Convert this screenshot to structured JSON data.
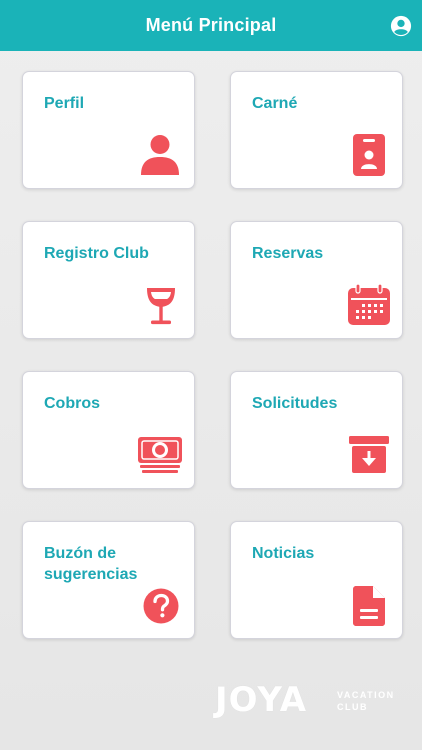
{
  "header": {
    "title": "Menú Principal",
    "profile_icon": "account-circle-icon"
  },
  "colors": {
    "header_bg": "#1ab3b8",
    "label_text": "#1ea8b4",
    "icon_accent": "#f0525a",
    "card_bg": "#ffffff"
  },
  "menu": {
    "items": [
      {
        "label": "Perfil",
        "icon": "person-icon"
      },
      {
        "label": "Carné",
        "icon": "id-badge-icon"
      },
      {
        "label": "Registro Club",
        "icon": "wine-glass-icon"
      },
      {
        "label": "Reservas",
        "icon": "calendar-icon"
      },
      {
        "label": "Cobros",
        "icon": "cash-icon"
      },
      {
        "label": "Solicitudes",
        "icon": "archive-download-icon"
      },
      {
        "label": "Buzón de sugerencias",
        "icon": "help-circle-icon"
      },
      {
        "label": "Noticias",
        "icon": "document-icon"
      }
    ]
  },
  "brand": {
    "name": "JOYA",
    "tagline_1": "VACATION",
    "tagline_2": "CLUB"
  }
}
